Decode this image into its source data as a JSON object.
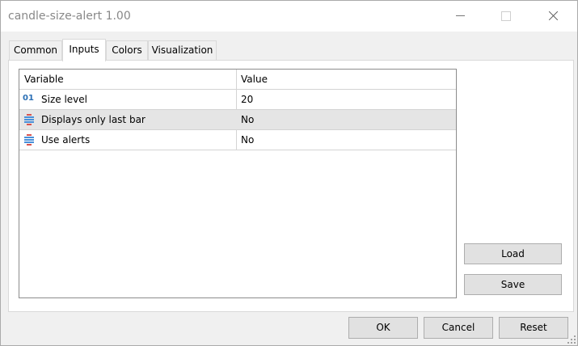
{
  "window": {
    "title": "candle-size-alert 1.00"
  },
  "tabs": [
    {
      "label": "Common"
    },
    {
      "label": "Inputs"
    },
    {
      "label": "Colors"
    },
    {
      "label": "Visualization"
    }
  ],
  "active_tab": "Inputs",
  "grid": {
    "columns": [
      "Variable",
      "Value"
    ],
    "rows": [
      {
        "icon": "integer-icon",
        "icon_text": "01",
        "variable": "Size level",
        "value": "20"
      },
      {
        "icon": "enum-icon",
        "variable": "Displays only last bar",
        "value": "No"
      },
      {
        "icon": "enum-icon",
        "variable": "Use alerts",
        "value": "No"
      }
    ]
  },
  "side_buttons": {
    "load": "Load",
    "save": "Save"
  },
  "footer_buttons": {
    "ok": "OK",
    "cancel": "Cancel",
    "reset": "Reset"
  }
}
